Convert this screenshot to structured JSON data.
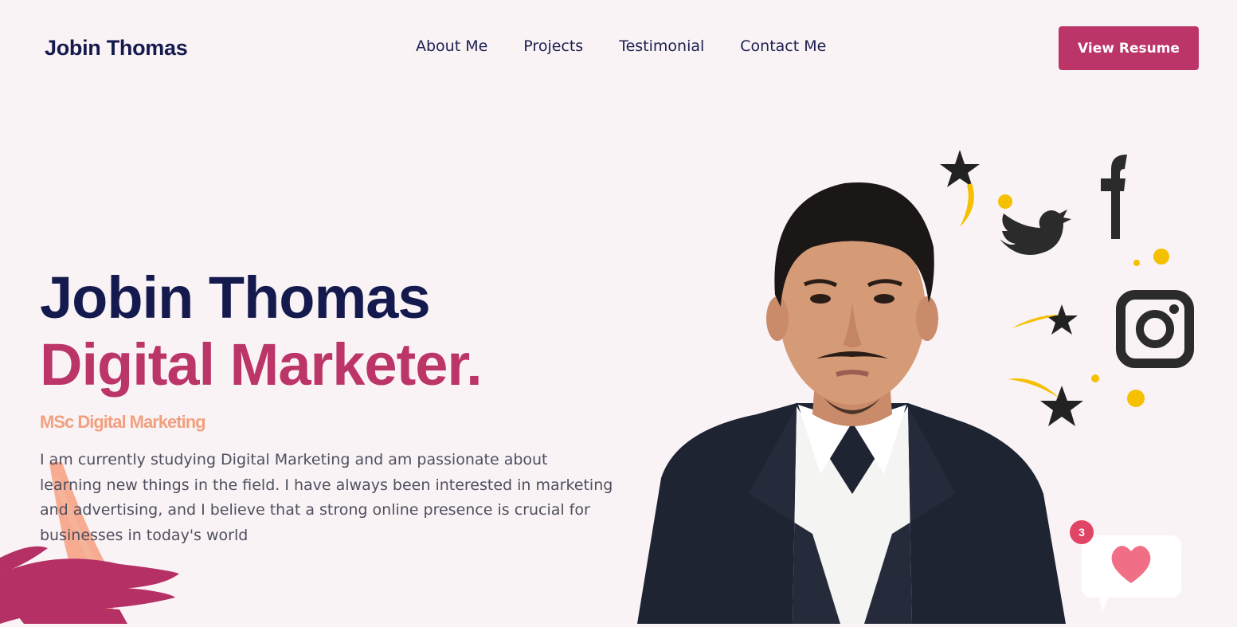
{
  "nav": {
    "logo": "Jobin Thomas",
    "links": [
      "About Me",
      "Projects",
      "Testimonial",
      "Contact Me"
    ],
    "resume_button": "View Resume"
  },
  "hero": {
    "name": "Jobin Thomas",
    "role": "Digital Marketer.",
    "degree": "MSc Digital Marketing",
    "bio": "I am currently studying Digital Marketing and am passionate about learning new things in the field. I have always been interested in marketing and advertising, and I believe that a strong online presence is crucial for businesses in today's world"
  },
  "notification": {
    "count": "3"
  },
  "icons": [
    "facebook-icon",
    "twitter-icon",
    "instagram-icon",
    "star-icon",
    "heart-icon"
  ],
  "colors": {
    "background": "#faf3f6",
    "navy": "#151a4e",
    "accent": "#bb3568",
    "peach": "#f1a080",
    "yellow": "#f4c000"
  }
}
